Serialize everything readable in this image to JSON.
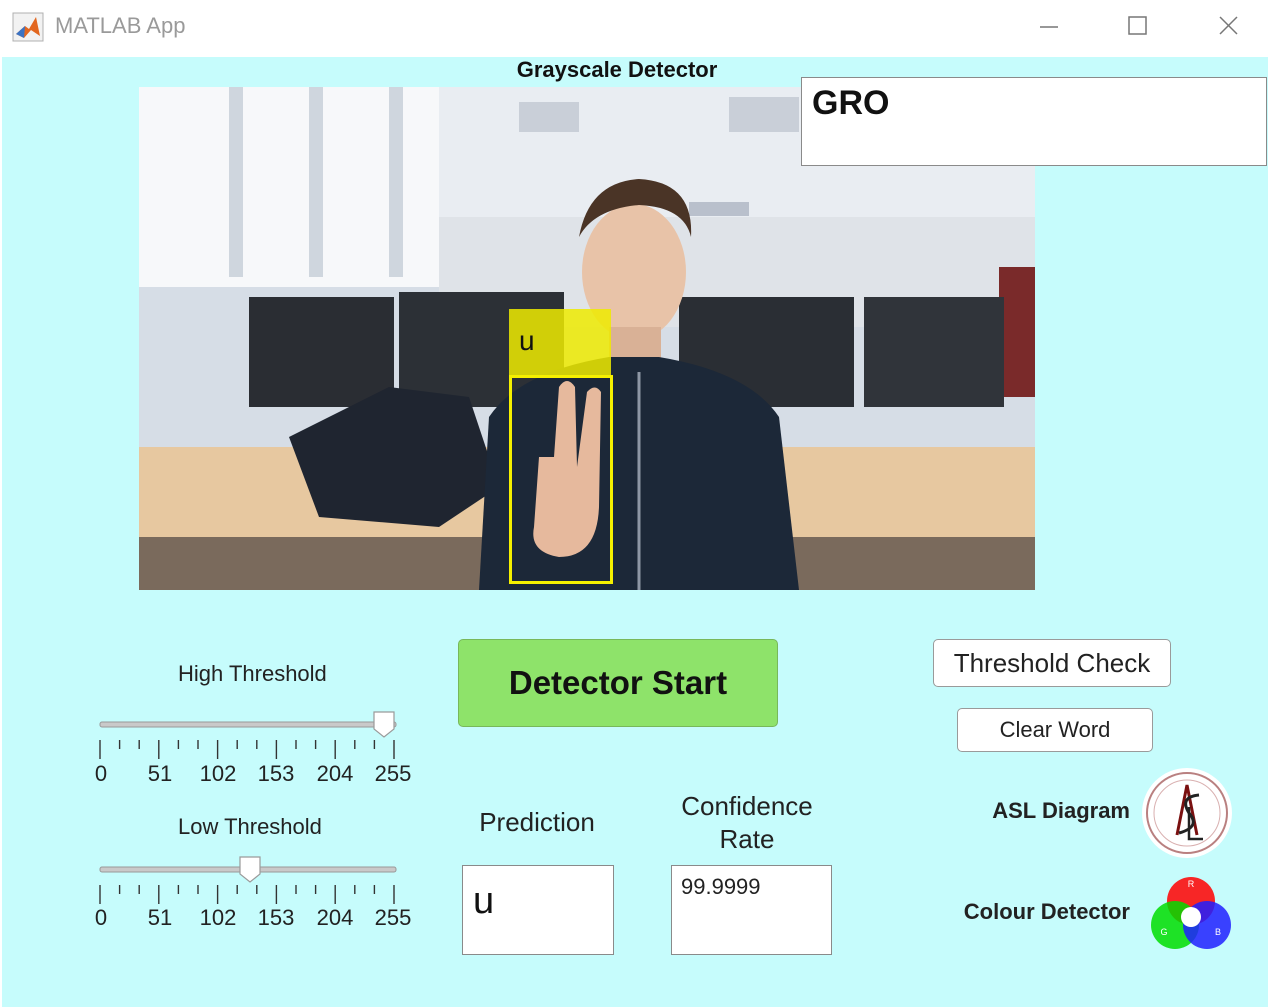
{
  "window": {
    "title": "MATLAB App"
  },
  "plot": {
    "title": "Grayscale Detector",
    "detection_label": "u"
  },
  "word_display": {
    "value": "GRO"
  },
  "buttons": {
    "detector_start": "Detector Start",
    "threshold_check": "Threshold Check",
    "clear_word": "Clear Word"
  },
  "high_threshold": {
    "label": "High Threshold",
    "value": 255,
    "ticks": [
      "0",
      "51",
      "102",
      "153",
      "204",
      "255"
    ]
  },
  "low_threshold": {
    "label": "Low Threshold",
    "value": 128,
    "ticks": [
      "0",
      "51",
      "102",
      "153",
      "204",
      "255"
    ]
  },
  "prediction": {
    "label": "Prediction",
    "value": "u"
  },
  "confidence": {
    "label_line1": "Confidence",
    "label_line2": "Rate",
    "value": "99.9999"
  },
  "asl_diagram": {
    "label": "ASL Diagram"
  },
  "colour_detector": {
    "label": "Colour Detector"
  },
  "icons": {
    "app": "matlab-icon",
    "minimize": "minimize-icon",
    "maximize": "maximize-icon",
    "close": "close-icon",
    "asl": "asl-logo-icon",
    "colour": "rgb-color-wheel-icon"
  },
  "colors": {
    "background": "#c6fcfc",
    "start_button": "#8ee36a",
    "detection_box": "#f5f000"
  }
}
